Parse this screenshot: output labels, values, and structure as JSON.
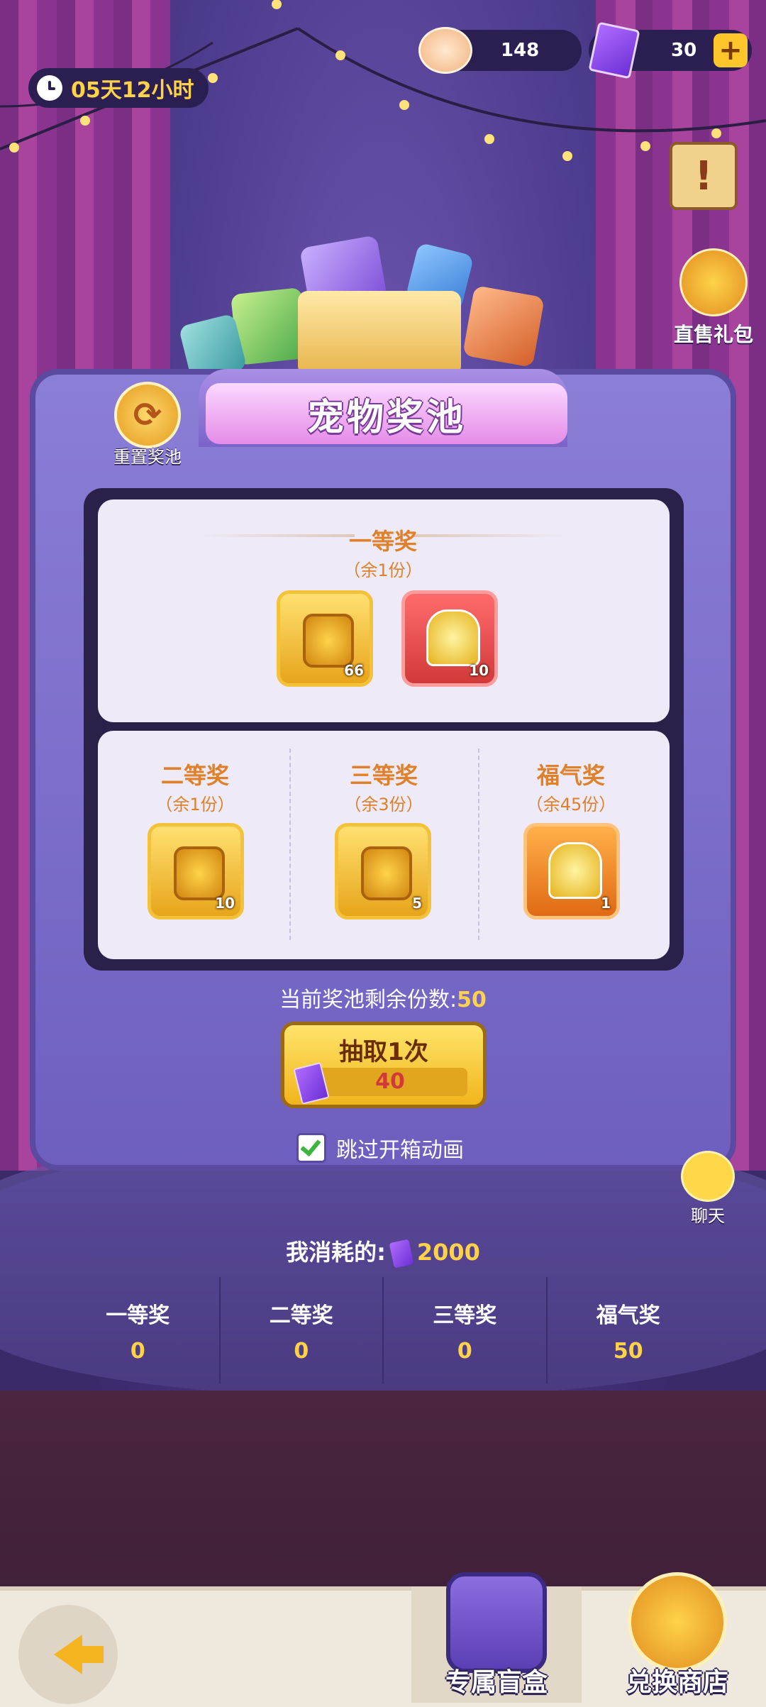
{
  "timer": {
    "text": "05天12小时",
    "icon": "clock-icon"
  },
  "currencies": {
    "shell": {
      "value": "148",
      "icon": "shell-icon"
    },
    "ticket": {
      "value": "30",
      "icon": "ticket-icon",
      "add_label": "+"
    }
  },
  "side": {
    "notice_label": "!",
    "gift_label": "直售礼包"
  },
  "panel": {
    "title": "宠物奖池",
    "reset_label": "重置奖池",
    "tiers": [
      {
        "title": "一等奖",
        "remain": "（余1份）",
        "items": [
          {
            "type": "coin",
            "qty": "66"
          },
          {
            "type": "trophy",
            "qty": "10"
          }
        ]
      },
      {
        "title": "二等奖",
        "remain": "（余1份）",
        "items": [
          {
            "type": "coin",
            "qty": "10"
          }
        ]
      },
      {
        "title": "三等奖",
        "remain": "（余3份）",
        "items": [
          {
            "type": "coin",
            "qty": "5"
          }
        ]
      },
      {
        "title": "福气奖",
        "remain": "（余45份）",
        "items": [
          {
            "type": "trophy",
            "qty": "1"
          }
        ]
      }
    ],
    "pool_remaining_label": "当前奖池剩余份数:",
    "pool_remaining_value": "50",
    "draw_label": "抽取1次",
    "draw_cost": "40",
    "skip_label": "跳过开箱动画",
    "skip_checked": true
  },
  "chat_label": "聊天",
  "spent": {
    "label": "我消耗的:",
    "value": "2000"
  },
  "stats": [
    {
      "title": "一等奖",
      "value": "0"
    },
    {
      "title": "二等奖",
      "value": "0"
    },
    {
      "title": "三等奖",
      "value": "0"
    },
    {
      "title": "福气奖",
      "value": "50"
    }
  ],
  "bottom_tabs": {
    "blind_box": "专属盲盒",
    "shop": "兑换商店"
  },
  "colors": {
    "accent_gold": "#ffd24a",
    "tier_text": "#e0802a",
    "panel": "#7b6cc9"
  }
}
